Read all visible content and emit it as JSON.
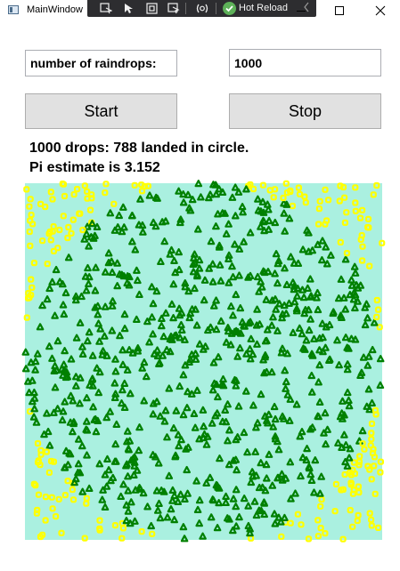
{
  "window": {
    "title": "MainWindow"
  },
  "devtoolbar": {
    "hot_reload_label": "Hot Reload",
    "icons": [
      "select-element-icon",
      "pointer-icon",
      "display-layout-icon",
      "track-focus-icon",
      "binding-failures-icon",
      "hot-reload-icon",
      "collapse-icon"
    ]
  },
  "form": {
    "label_text": "number of raindrops:",
    "drops_value": "1000",
    "start_label": "Start",
    "stop_label": "Stop"
  },
  "results": {
    "line1": "1000 drops: 788 landed in circle.",
    "line2": "Pi estimate is 3.152"
  },
  "simulation": {
    "total_drops": 1000,
    "inside_drops": 788,
    "square_color": "#aaf0e0",
    "inside_color": "#008000",
    "outside_color": "#ffff00"
  },
  "colors": {
    "devtoolbar_bg": "#2d2d30",
    "hot_reload_green": "#5db058",
    "button_bg": "#e1e1e1"
  }
}
